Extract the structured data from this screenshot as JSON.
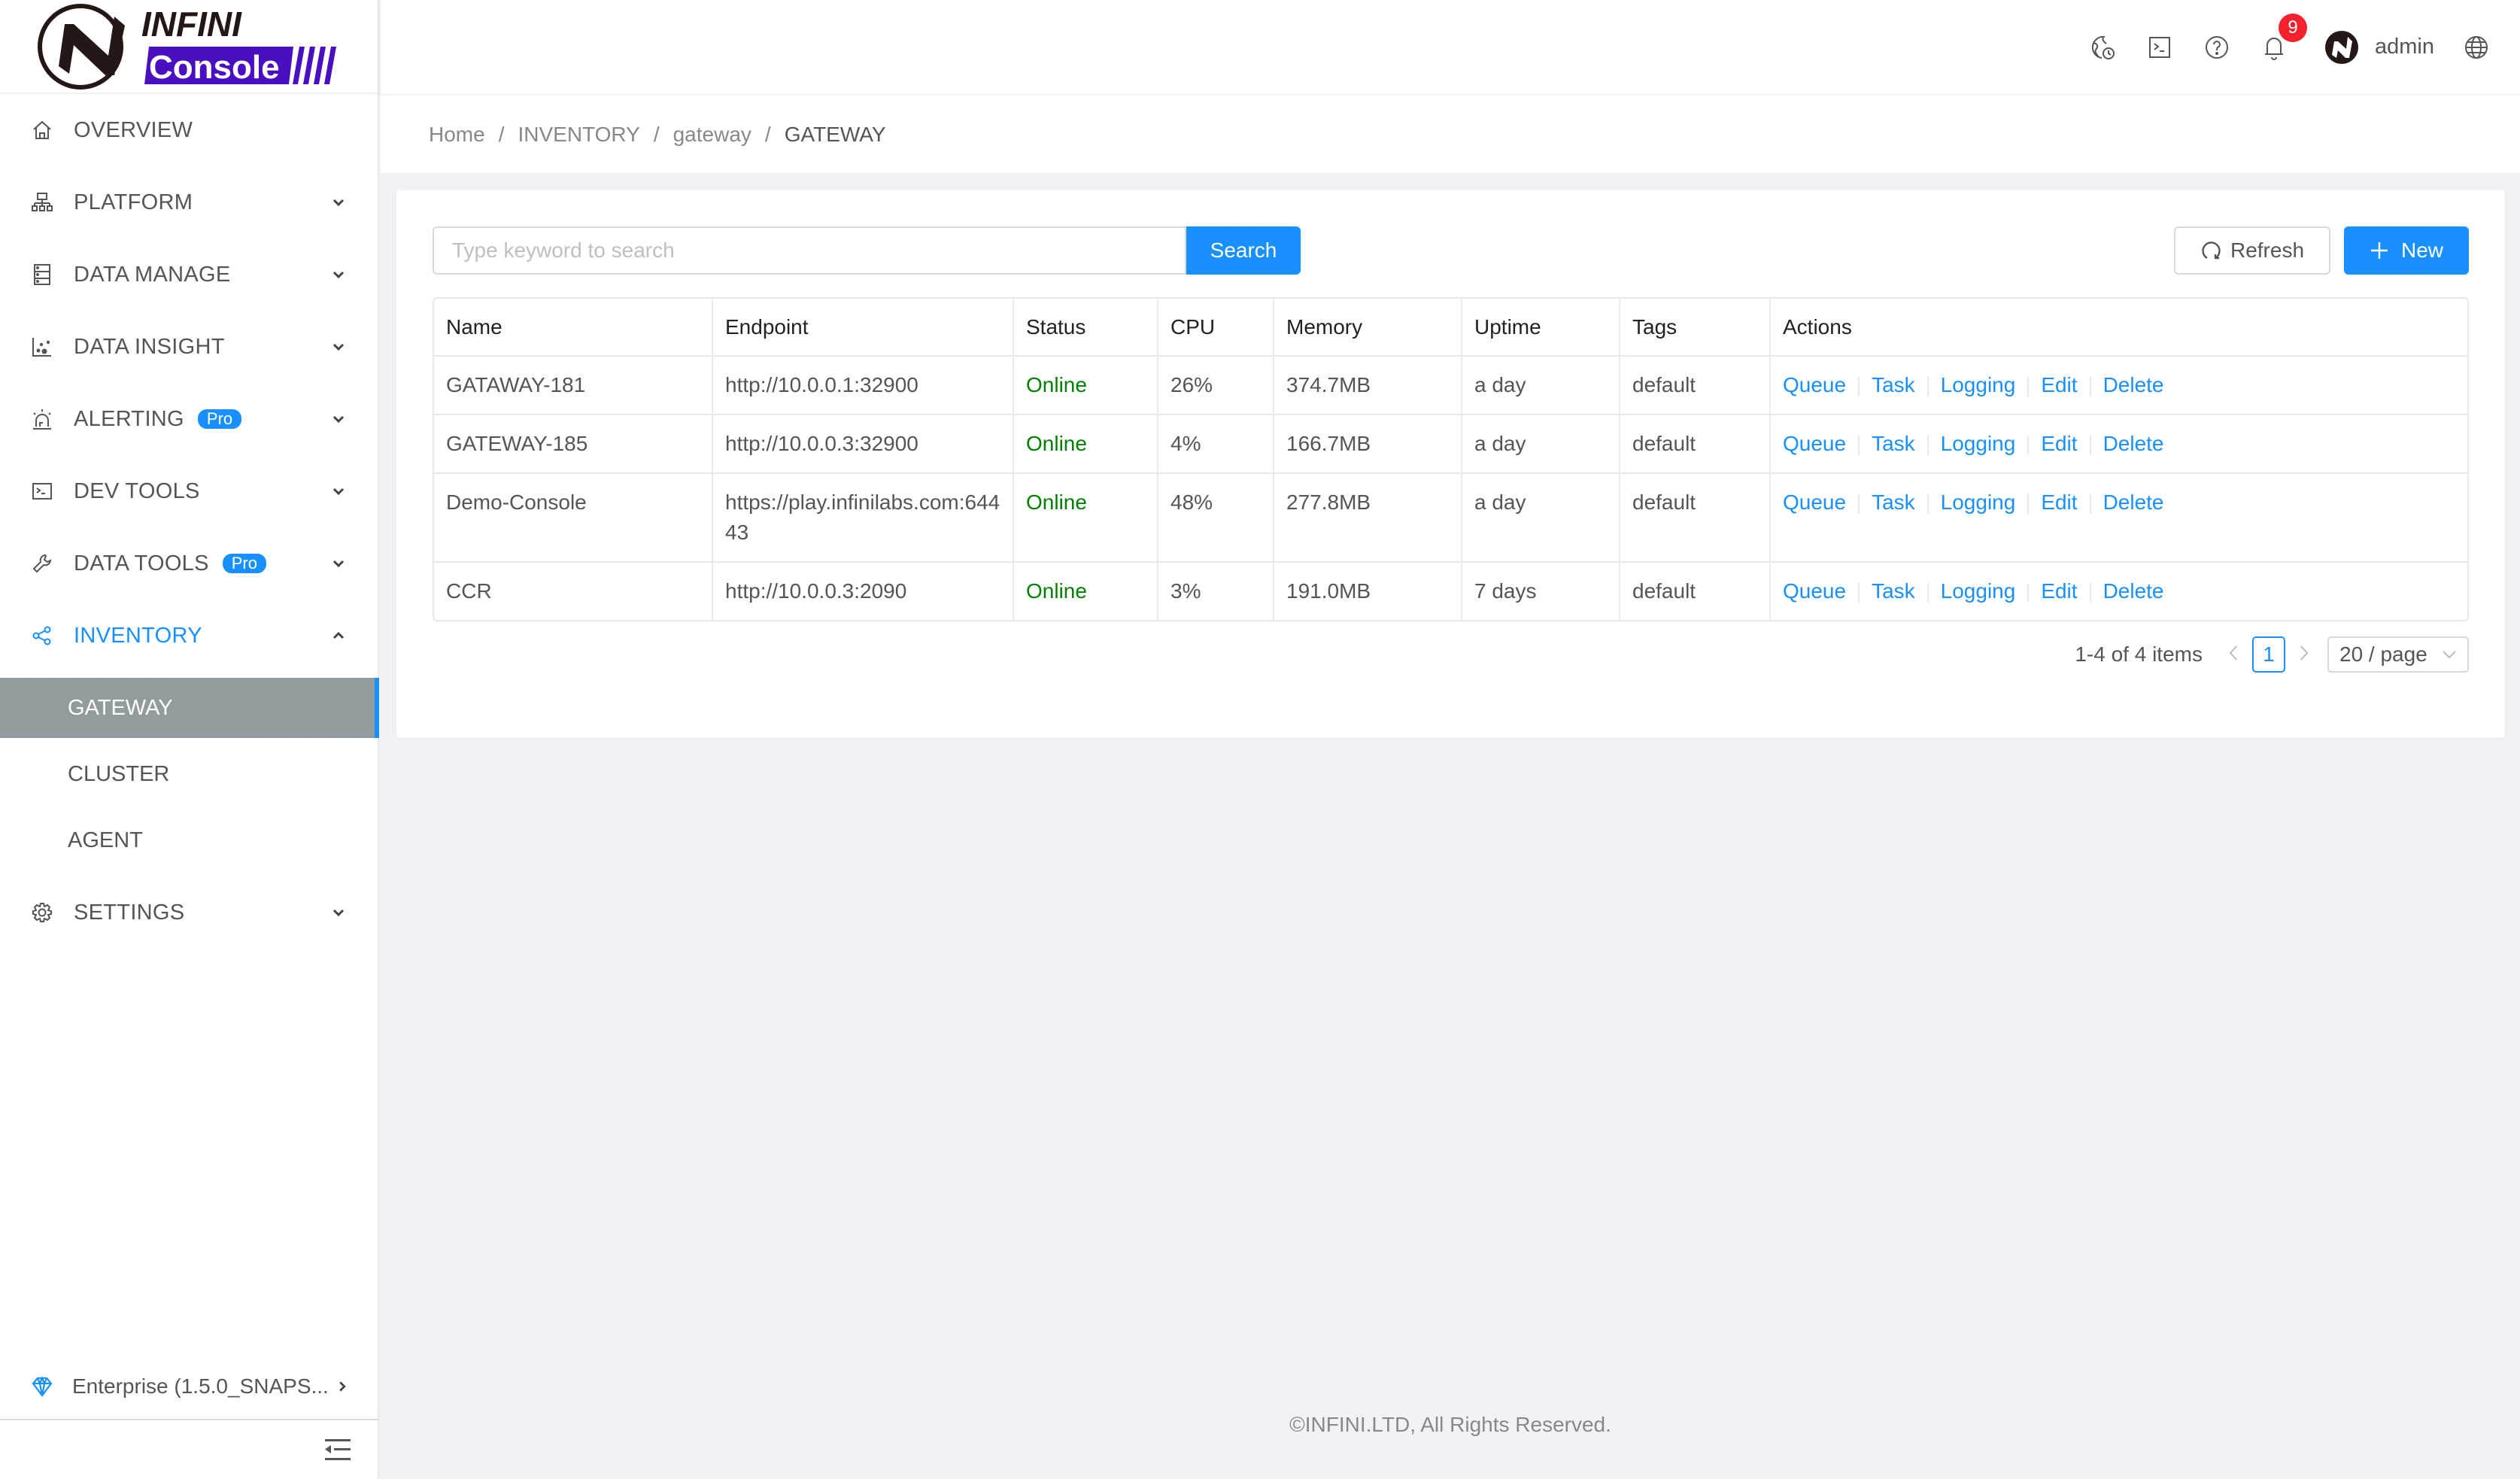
{
  "app": {
    "logo_top": "INFINI",
    "logo_bottom": "Console",
    "brand_color": "#4a0fc0"
  },
  "header": {
    "icons": [
      "timezone-globe-icon",
      "terminal-icon",
      "help-icon",
      "notification-bell-icon",
      "language-globe-icon"
    ],
    "notification_count": "9",
    "user_name": "admin"
  },
  "sidebar": {
    "items": [
      {
        "label": "OVERVIEW",
        "icon": "home-icon",
        "expandable": false
      },
      {
        "label": "PLATFORM",
        "icon": "cluster-icon",
        "expandable": true
      },
      {
        "label": "DATA MANAGE",
        "icon": "database-icon",
        "expandable": true
      },
      {
        "label": "DATA INSIGHT",
        "icon": "scatter-chart-icon",
        "expandable": true
      },
      {
        "label": "ALERTING",
        "icon": "alarm-icon",
        "expandable": true,
        "badge": "Pro"
      },
      {
        "label": "DEV TOOLS",
        "icon": "terminal-icon",
        "expandable": true
      },
      {
        "label": "DATA TOOLS",
        "icon": "wrench-icon",
        "expandable": true,
        "badge": "Pro"
      },
      {
        "label": "INVENTORY",
        "icon": "share-icon",
        "expandable": true,
        "open": true
      },
      {
        "label": "SETTINGS",
        "icon": "gear-icon",
        "expandable": true
      }
    ],
    "inventory_children": [
      {
        "label": "GATEWAY",
        "selected": true
      },
      {
        "label": "CLUSTER"
      },
      {
        "label": "AGENT"
      }
    ],
    "edition": "Enterprise (1.5.0_SNAPS...",
    "accent": "#1890ff"
  },
  "breadcrumb": [
    "Home",
    "INVENTORY",
    "gateway",
    "GATEWAY"
  ],
  "toolbar": {
    "search_placeholder": "Type keyword to search",
    "search_value": "",
    "search_label": "Search",
    "refresh_label": "Refresh",
    "new_label": "New"
  },
  "table": {
    "columns": [
      "Name",
      "Endpoint",
      "Status",
      "CPU",
      "Memory",
      "Uptime",
      "Tags",
      "Actions"
    ],
    "rows": [
      {
        "name": "GATAWAY-181",
        "endpoint": "http://10.0.0.1:32900",
        "status": "Online",
        "cpu": "26%",
        "memory": "374.7MB",
        "uptime": "a day",
        "tags": "default"
      },
      {
        "name": "GATEWAY-185",
        "endpoint": "http://10.0.0.3:32900",
        "status": "Online",
        "cpu": "4%",
        "memory": "166.7MB",
        "uptime": "a day",
        "tags": "default"
      },
      {
        "name": "Demo-Console",
        "endpoint": "https://play.infinilabs.com:64443",
        "status": "Online",
        "cpu": "48%",
        "memory": "277.8MB",
        "uptime": "a day",
        "tags": "default"
      },
      {
        "name": "CCR",
        "endpoint": "http://10.0.0.3:2090",
        "status": "Online",
        "cpu": "3%",
        "memory": "191.0MB",
        "uptime": "7 days",
        "tags": "default"
      }
    ],
    "actions": [
      "Queue",
      "Task",
      "Logging",
      "Edit",
      "Delete"
    ],
    "status_color": "#008000",
    "link_color": "#1890ff"
  },
  "pagination": {
    "summary": "1-4 of 4 items",
    "current_page": "1",
    "page_size": "20 / page"
  },
  "footer": {
    "copyright": "©INFINI.LTD, All Rights Reserved."
  }
}
